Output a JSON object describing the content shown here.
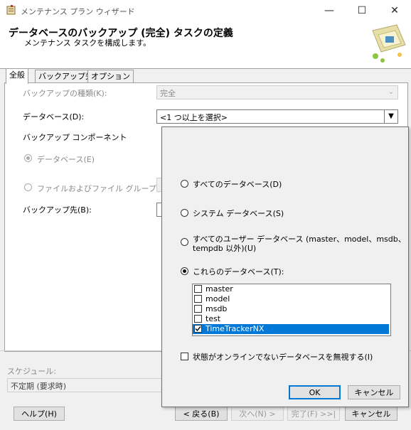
{
  "window": {
    "title": "メンテナンス プラン ウィザード",
    "minimize_glyph": "—",
    "maximize_glyph": "☐",
    "close_glyph": "✕"
  },
  "header": {
    "title": "データベースのバックアップ (完全) タスクの定義",
    "subtitle": "メンテナンス タスクを構成します。"
  },
  "tabs": [
    {
      "label": "全般",
      "active": true
    },
    {
      "label": "バックアップ先",
      "active": false
    },
    {
      "label": "オプション",
      "active": false
    }
  ],
  "general": {
    "backup_type_label": "バックアップの種類(K):",
    "backup_type_value": "完全",
    "database_label": "データベース(D):",
    "database_value": "<1 つ以上を選択>",
    "backup_component_label": "バックアップ コンポーネント",
    "component_database": "データベース(E)",
    "component_files": "ファイルおよびファイル グループ(G):",
    "backup_to_label": "バックアップ先(B):"
  },
  "schedule": {
    "label": "スケジュール:",
    "value": "不定期 (要求時)"
  },
  "footer": {
    "help": "ヘルプ(H)",
    "back": "< 戻る(B)",
    "next": "次へ(N) >",
    "finish": "完了(F) >>|",
    "cancel": "キャンセル"
  },
  "popup": {
    "opt_all": "すべてのデータベース(D)",
    "opt_system": "システム データベース(S)",
    "opt_user_line1": "すべてのユーザー データベース (master、model、msdb、",
    "opt_user_line2": "tempdb 以外)(U)",
    "opt_these": "これらのデータベース(T):",
    "databases": [
      {
        "name": "master",
        "checked": false,
        "selected": false
      },
      {
        "name": "model",
        "checked": false,
        "selected": false
      },
      {
        "name": "msdb",
        "checked": false,
        "selected": false
      },
      {
        "name": "test",
        "checked": false,
        "selected": false
      },
      {
        "name": "TimeTrackerNX",
        "checked": true,
        "selected": true
      }
    ],
    "ignore_offline": "状態がオンラインでないデータベースを無視する(I)",
    "ok": "OK",
    "cancel": "キャンセル"
  },
  "colors": {
    "selection": "#0078d7",
    "dialog_bg": "#f0f0f0",
    "disabled_text": "#8a8a8a"
  }
}
